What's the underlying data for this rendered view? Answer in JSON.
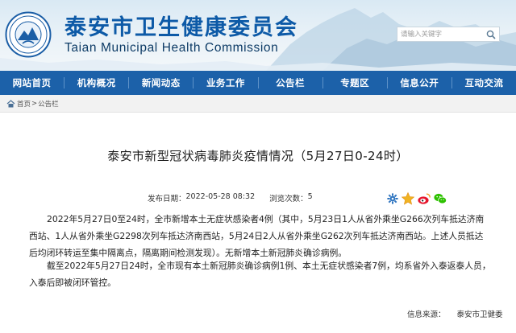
{
  "header": {
    "title_cn": "泰安市卫生健康委员会",
    "title_en": "Taian Municipal Health Commission",
    "search_placeholder": "请输入关键字"
  },
  "nav": {
    "items": [
      "网站首页",
      "机构概况",
      "新闻动态",
      "业务工作",
      "公告栏",
      "专题区",
      "信息公开",
      "互动交流"
    ]
  },
  "breadcrumb": {
    "home": "首页",
    "separator": ">",
    "current": "公告栏"
  },
  "article": {
    "title": "泰安市新型冠状病毒肺炎疫情情况（5月27日0-24时）",
    "publish_label": "发布日期：",
    "publish_date": "2022-05-28 08:32",
    "views_label": "浏览次数：",
    "views": "5",
    "share_icons": [
      "gear-icon",
      "weibo-icon",
      "wechat-icon"
    ],
    "paragraphs": [
      "2022年5月27日0至24时，全市新增本土无症状感染者4例（其中，5月23日1人从省外乘坐G266次列车抵达济南西站、1人从省外乘坐G2298次列车抵达济南西站，5月24日2人从省外乘坐G262次列车抵达济南西站。上述人员抵达后均闭环转运至集中隔离点，隔离期间检测发现）。无新增本土新冠肺炎确诊病例。",
      "截至2022年5月27日24时，全市现有本土新冠肺炎确诊病例1例、本土无症状感染者7例，均系省外入泰返泰人员，入泰后即被闭环管控。"
    ],
    "source_label": "信息来源：",
    "source": "泰安市卫健委"
  },
  "colors": {
    "nav_bg": "#1c61a9",
    "title_blue": "#0d5aa7"
  }
}
